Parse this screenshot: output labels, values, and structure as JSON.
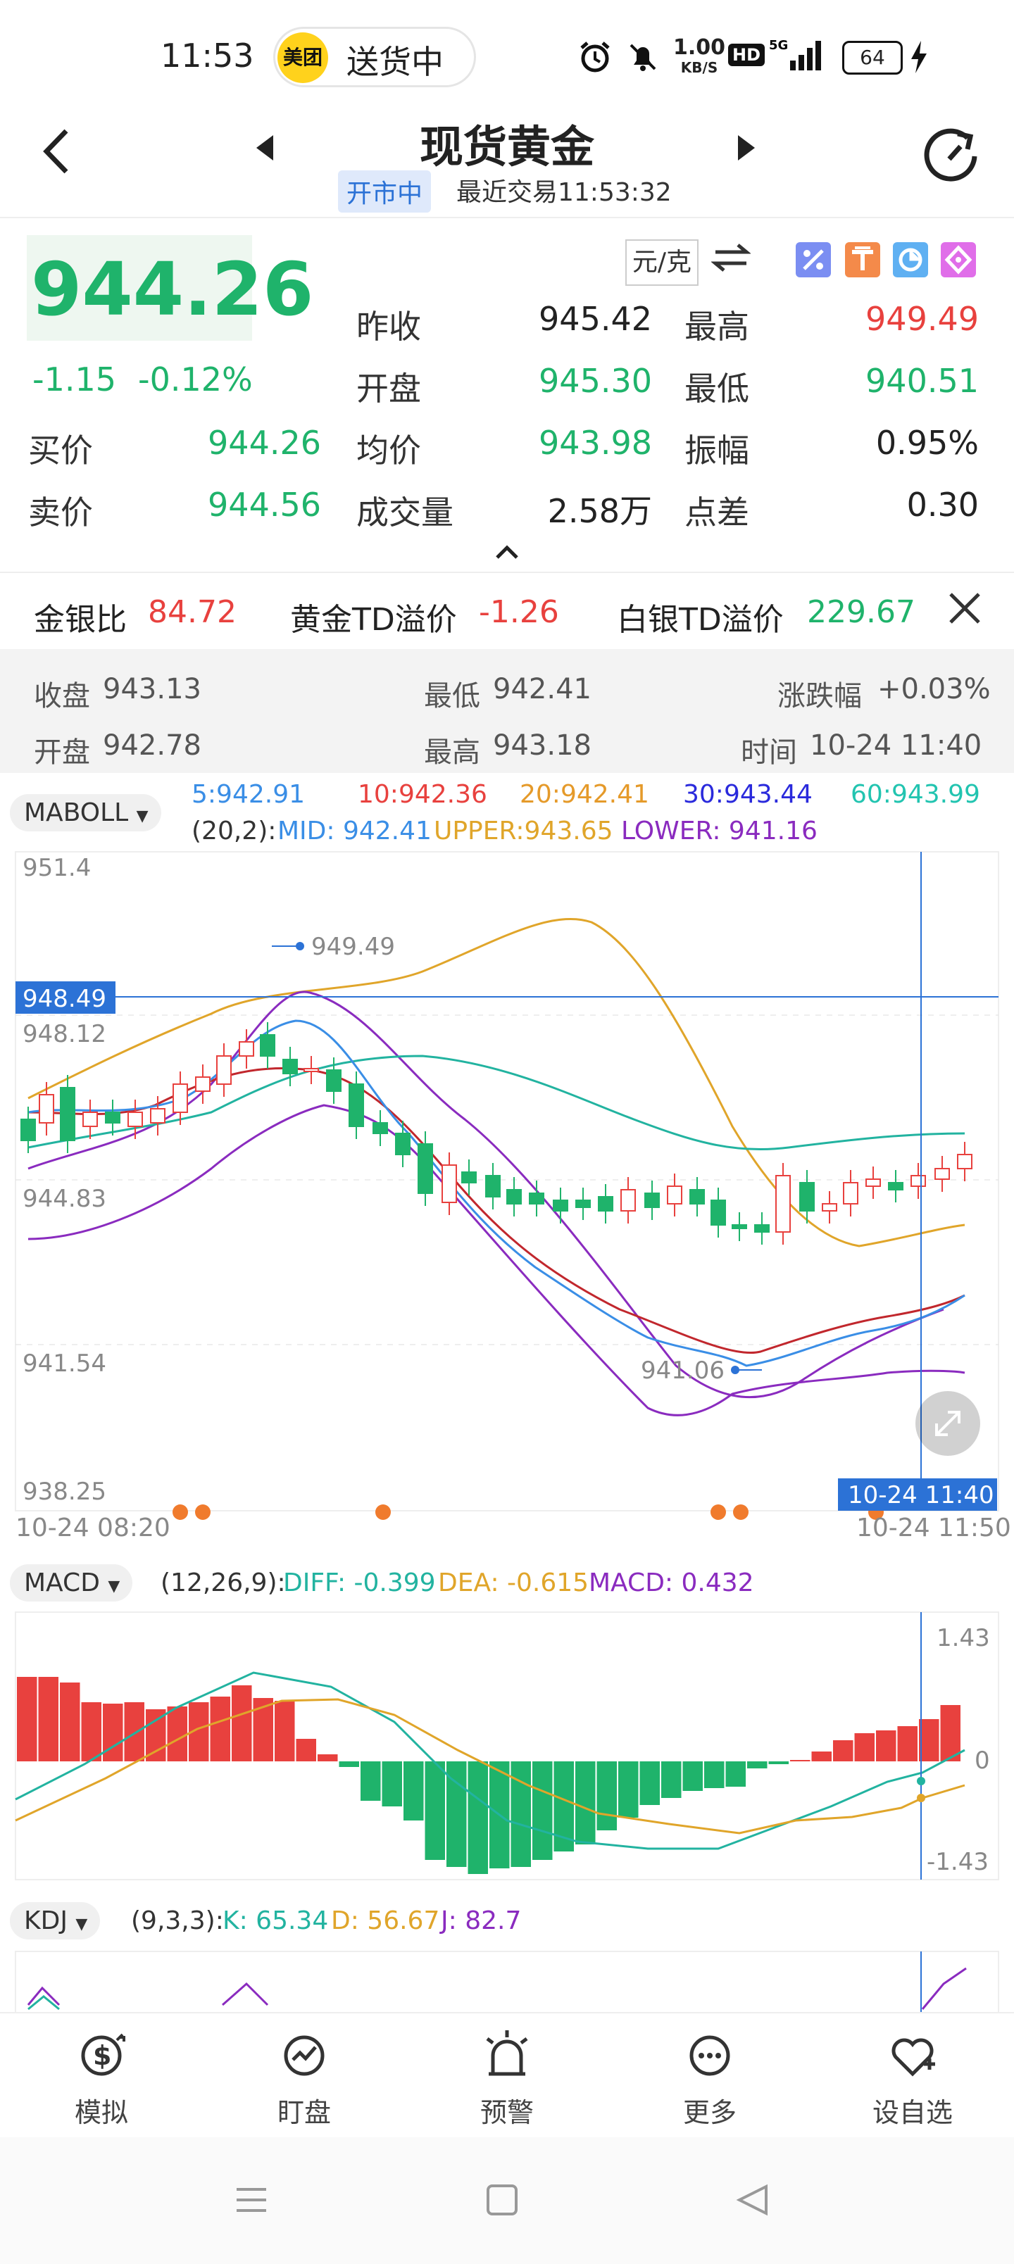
{
  "status_bar": {
    "time": "11:53",
    "app_badge": "美团",
    "delivery_text": "送货中",
    "net_speed": "1.00",
    "net_unit": "KB/S",
    "hd": "HD",
    "signal": "5G",
    "battery": "64"
  },
  "header": {
    "title": "现货黄金",
    "market_status": "开市中",
    "last_trade": "最近交易11:53:32"
  },
  "quote": {
    "price": "944.26",
    "change": "-1.15",
    "change_pct": "-0.12%",
    "unit": "元/克",
    "prev_close_label": "昨收",
    "prev_close": "945.42",
    "high_label": "最高",
    "high": "949.49",
    "open_label": "开盘",
    "open": "945.30",
    "low_label": "最低",
    "low": "940.51",
    "bid_label": "买价",
    "bid": "944.26",
    "avg_label": "均价",
    "avg": "943.98",
    "amplitude_label": "振幅",
    "amplitude": "0.95%",
    "ask_label": "卖价",
    "ask": "944.56",
    "volume_label": "成交量",
    "volume": "2.58万",
    "spread_label": "点差",
    "spread": "0.30"
  },
  "ratios": {
    "gold_silver_label": "金银比",
    "gold_silver": "84.72",
    "gold_td_label": "黄金TD溢价",
    "gold_td": "-1.26",
    "silver_td_label": "白银TD溢价",
    "silver_td": "229.67"
  },
  "ohlc_info": {
    "close_label": "收盘",
    "close": "943.13",
    "low_label": "最低",
    "low": "942.41",
    "chg_label": "涨跌幅",
    "chg": "+0.03%",
    "open_label": "开盘",
    "open": "942.78",
    "high_label": "最高",
    "high": "943.18",
    "time_label": "时间",
    "time": "10-24 11:40"
  },
  "main_chart": {
    "indicator": "MABOLL",
    "ma5": "5:942.91",
    "ma10": "10:942.36",
    "ma20": "20:942.41",
    "ma30": "30:943.44",
    "ma60": "60:943.99",
    "boll_params": "(20,2):",
    "boll_mid": "MID: 942.41",
    "boll_upper": "UPPER:943.65",
    "boll_lower": "LOWER: 941.16",
    "y_labels": [
      "951.4",
      "948.12",
      "944.83",
      "941.54",
      "938.25"
    ],
    "crosshair_price": "948.49",
    "crosshair_time": "10-24 11:40",
    "max_marker": "949.49",
    "min_marker": "941.06",
    "x_start": "10-24 08:20",
    "x_end": "10-24 11:50"
  },
  "macd": {
    "indicator": "MACD",
    "params": "(12,26,9):",
    "diff": "DIFF: -0.399",
    "dea": "DEA: -0.615",
    "macd": "MACD: 0.432",
    "y_top": "1.43",
    "y_mid": "0",
    "y_bottom": "-1.43"
  },
  "kdj": {
    "indicator": "KDJ",
    "params": "(9,3,3):",
    "k": "K: 65.34",
    "d": "D: 56.67",
    "j": "J: 82.7"
  },
  "nav": {
    "items": [
      "模拟",
      "盯盘",
      "预警",
      "更多",
      "设自选"
    ]
  },
  "colors": {
    "up": "#e8413e",
    "down": "#1fb36b",
    "ma5": "#3a8ee6",
    "ma10": "#c1272d",
    "ma20": "#e0a52a",
    "ma30": "#8a2bbf",
    "ma60": "#22b3a0"
  }
}
